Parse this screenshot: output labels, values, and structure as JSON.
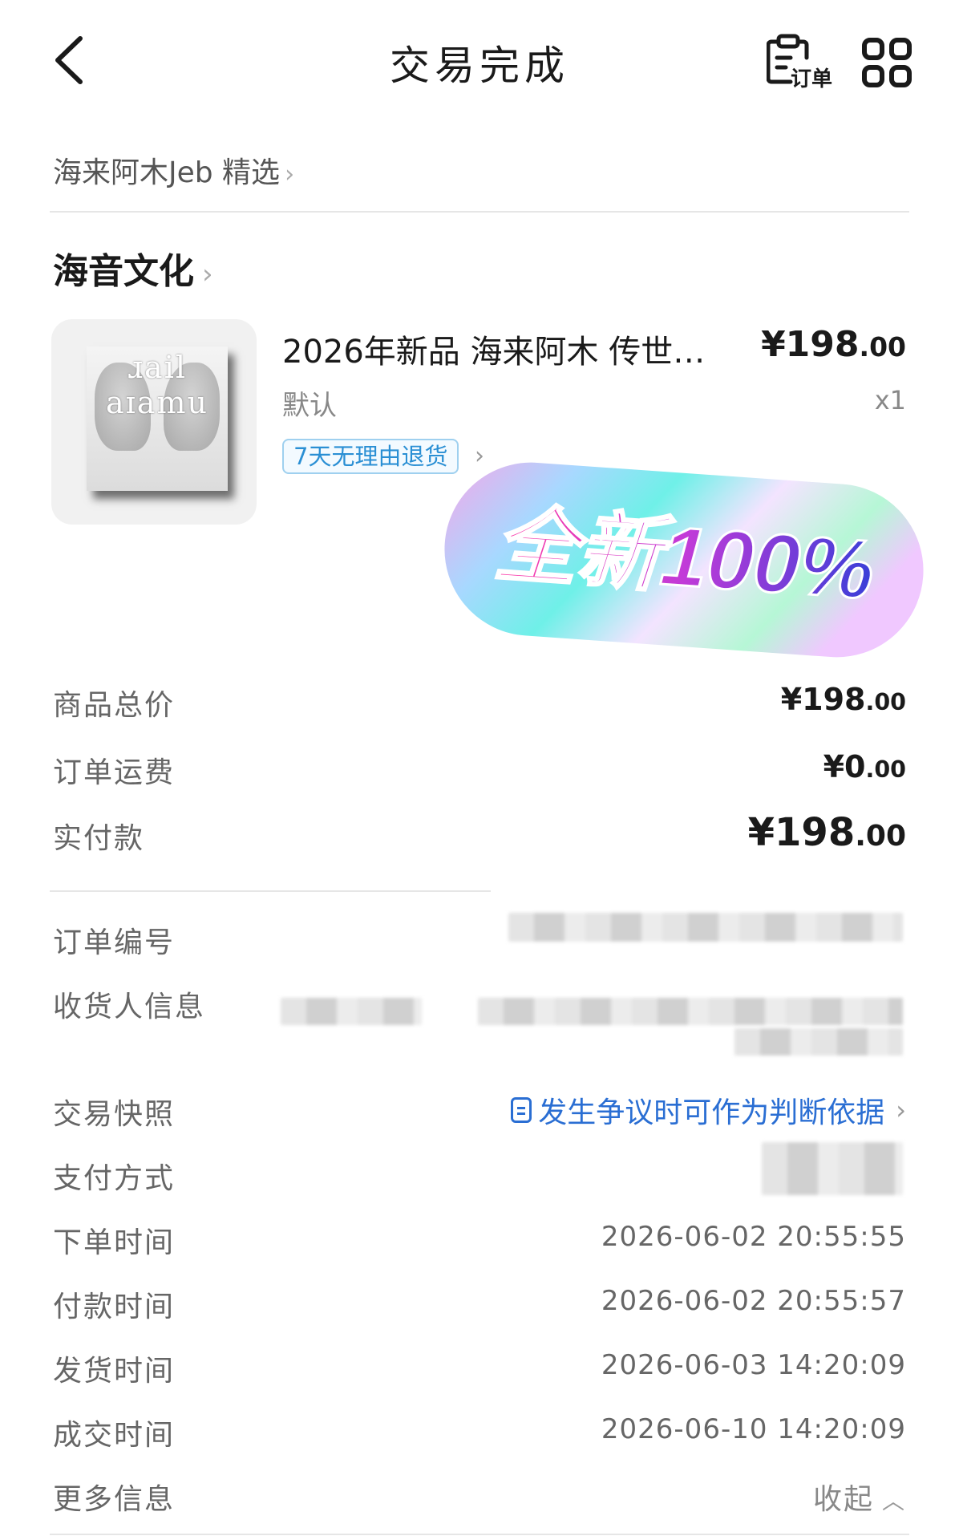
{
  "header": {
    "title": "交易完成",
    "order_label": "订单",
    "back_icon": "chevron-left-icon",
    "order_icon": "clipboard-icon",
    "apps_icon": "grid-icon"
  },
  "shop_link": "海来阿木Jeb 精选",
  "store": {
    "name": "海音文化"
  },
  "product": {
    "title": "2026年新品 海来阿木 传世…",
    "price_main": "¥198",
    "price_decimal": ".00",
    "spec": "默认",
    "qty": "x1",
    "return_tag": "7天无理由退货",
    "cover_script": "ɹail aɪamu"
  },
  "sticker": {
    "text": "全新100%"
  },
  "summary": {
    "goods_total_label": "商品总价",
    "goods_total_main": "¥198",
    "goods_total_decimal": ".00",
    "shipping_label": "订单运费",
    "shipping_main": "¥0",
    "shipping_decimal": ".00",
    "paid_label": "实付款",
    "paid_main": "¥198",
    "paid_decimal": ".00"
  },
  "info": {
    "order_no_label": "订单编号",
    "receiver_label": "收货人信息",
    "snapshot_label": "交易快照",
    "snapshot_link": "发生争议时可作为判断依据",
    "payment_label": "支付方式",
    "order_time_label": "下单时间",
    "order_time": "2026-06-02 20:55:55",
    "pay_time_label": "付款时间",
    "pay_time": "2026-06-02 20:55:57",
    "ship_time_label": "发货时间",
    "ship_time": "2026-06-03 14:20:09",
    "deal_time_label": "成交时间",
    "deal_time": "2026-06-10 14:20:09",
    "more_label": "更多信息",
    "collapse_label": "收起"
  },
  "colors": {
    "link_blue": "#2a6ed3",
    "tag_blue": "#2a8fd4",
    "text_dark": "#1a1a1a",
    "text_grey": "#666666"
  }
}
